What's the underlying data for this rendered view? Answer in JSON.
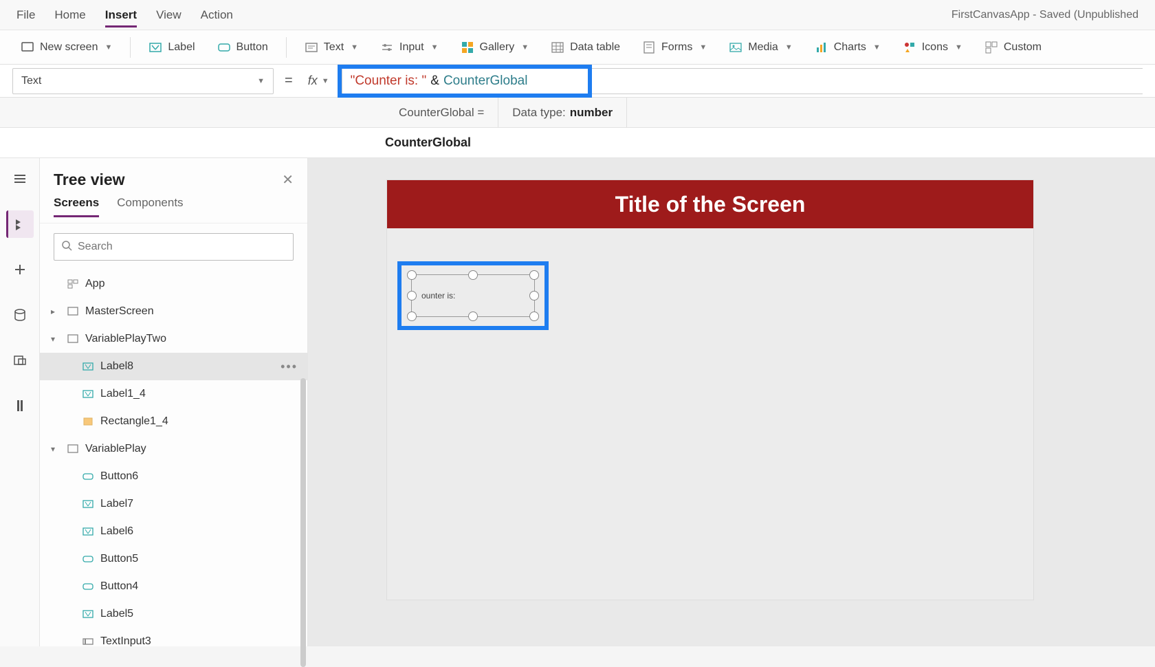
{
  "menu": {
    "items": [
      "File",
      "Home",
      "Insert",
      "View",
      "Action"
    ],
    "active": "Insert",
    "app_title": "FirstCanvasApp - Saved (Unpublished"
  },
  "ribbon": {
    "new_screen": "New screen",
    "label": "Label",
    "button": "Button",
    "text": "Text",
    "input": "Input",
    "gallery": "Gallery",
    "data_table": "Data table",
    "forms": "Forms",
    "media": "Media",
    "charts": "Charts",
    "icons": "Icons",
    "custom": "Custom"
  },
  "formula": {
    "property": "Text",
    "eq": "=",
    "fx": "fx",
    "tok_str": "\"Counter is: \"",
    "tok_op": "&",
    "tok_var": "CounterGlobal",
    "info_var_label": "CounterGlobal  =",
    "info_type_label": "Data type:",
    "info_type_value": "number",
    "suggestion": "CounterGlobal"
  },
  "tree": {
    "title": "Tree view",
    "tabs": {
      "screens": "Screens",
      "components": "Components"
    },
    "search_placeholder": "Search",
    "items": [
      {
        "id": "app",
        "label": "App",
        "icon": "app",
        "indent": 0
      },
      {
        "id": "master",
        "label": "MasterScreen",
        "icon": "screen",
        "indent": 0,
        "exp": ">"
      },
      {
        "id": "vp2",
        "label": "VariablePlayTwo",
        "icon": "screen",
        "indent": 0,
        "exp": "v"
      },
      {
        "id": "label8",
        "label": "Label8",
        "icon": "label",
        "indent": 2,
        "selected": true,
        "more": true
      },
      {
        "id": "label1_4",
        "label": "Label1_4",
        "icon": "label",
        "indent": 2
      },
      {
        "id": "rect1_4",
        "label": "Rectangle1_4",
        "icon": "rect",
        "indent": 2
      },
      {
        "id": "vp",
        "label": "VariablePlay",
        "icon": "screen",
        "indent": 0,
        "exp": "v"
      },
      {
        "id": "btn6",
        "label": "Button6",
        "icon": "button",
        "indent": 2
      },
      {
        "id": "label7",
        "label": "Label7",
        "icon": "label",
        "indent": 2
      },
      {
        "id": "label6",
        "label": "Label6",
        "icon": "label",
        "indent": 2
      },
      {
        "id": "btn5",
        "label": "Button5",
        "icon": "button",
        "indent": 2
      },
      {
        "id": "btn4",
        "label": "Button4",
        "icon": "button",
        "indent": 2
      },
      {
        "id": "label5",
        "label": "Label5",
        "icon": "label",
        "indent": 2
      },
      {
        "id": "ti3",
        "label": "TextInput3",
        "icon": "textinput",
        "indent": 2
      }
    ]
  },
  "canvas": {
    "screen_title": "Title of the Screen",
    "label_text": "ounter is:"
  }
}
